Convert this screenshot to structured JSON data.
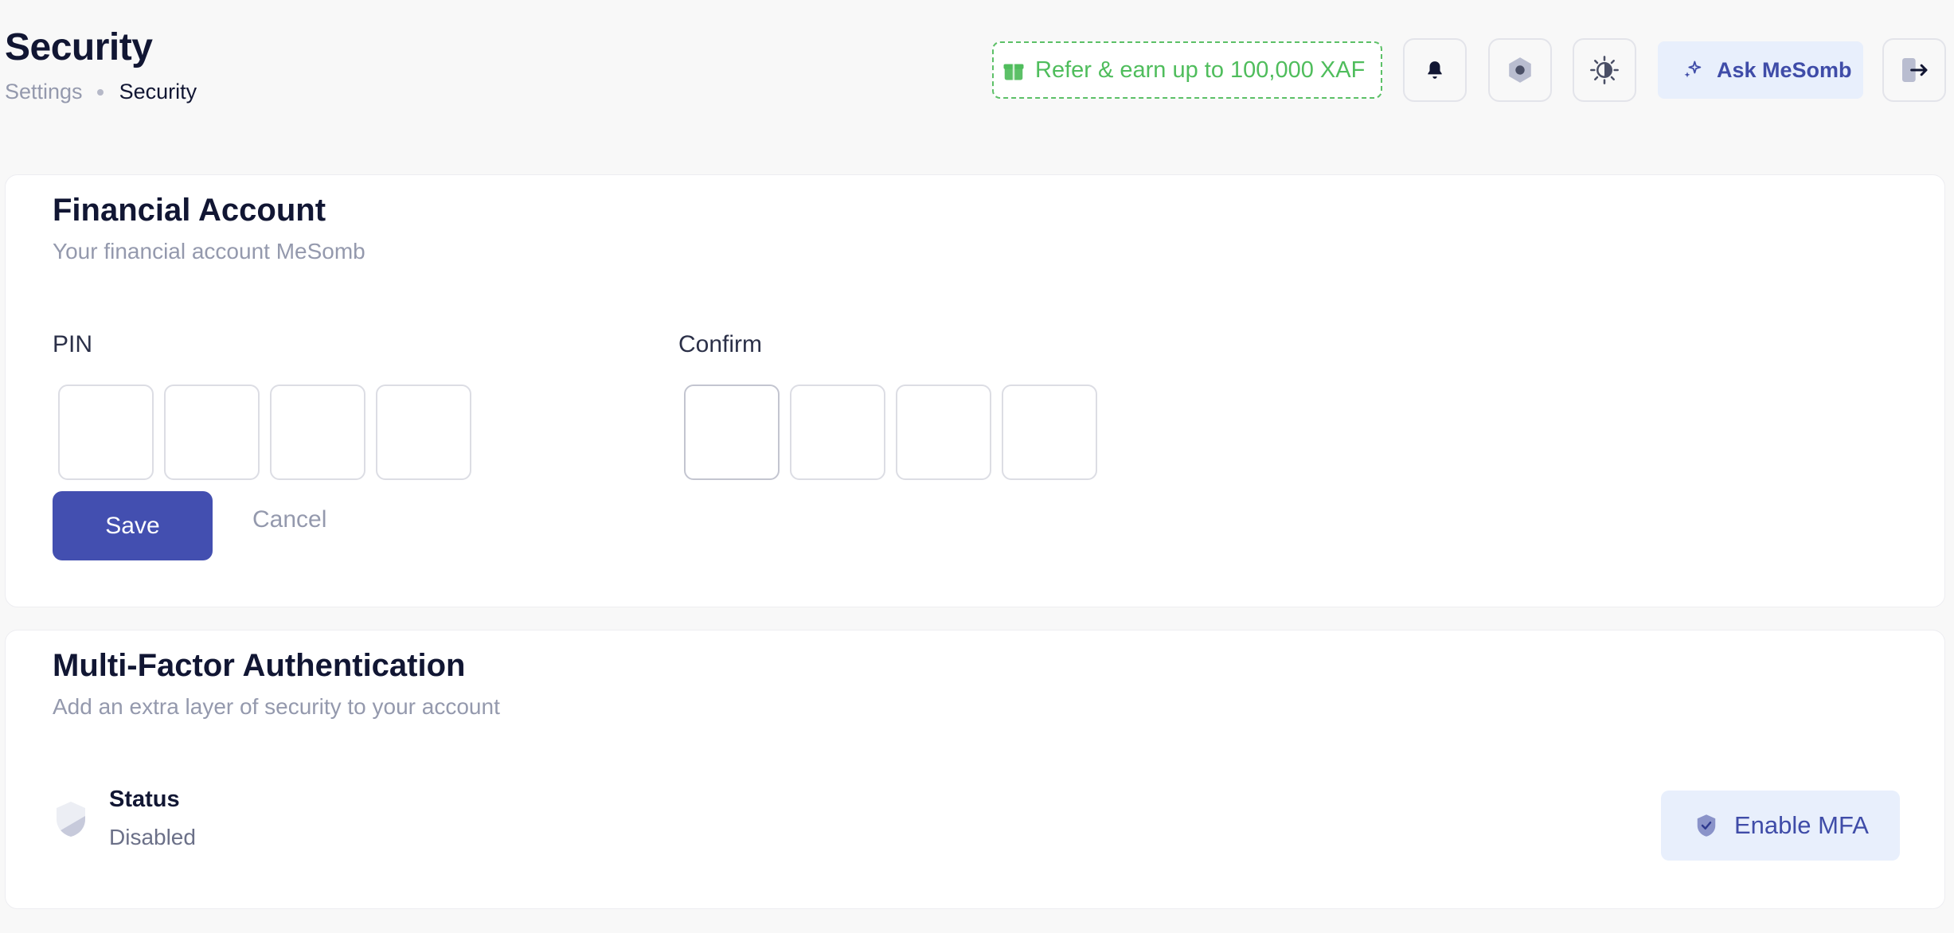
{
  "header": {
    "title": "Security",
    "breadcrumb": {
      "parent": "Settings",
      "current": "Security"
    },
    "refer_label": "Refer & earn up to 100,000 XAF",
    "ask_label": "Ask MeSomb",
    "icons": [
      "gift-icon",
      "bell-icon",
      "hexagon-icon",
      "theme-toggle-icon",
      "sparkles-icon",
      "logout-icon"
    ]
  },
  "financial_account": {
    "title": "Financial Account",
    "subtitle": "Your financial account MeSomb",
    "pin_label": "PIN",
    "confirm_label": "Confirm",
    "pin_values": [
      "",
      "",
      "",
      ""
    ],
    "confirm_values": [
      "",
      "",
      "",
      ""
    ],
    "save_label": "Save",
    "cancel_label": "Cancel"
  },
  "mfa": {
    "title": "Multi-Factor Authentication",
    "subtitle": "Add an extra layer of security to your account",
    "status_label": "Status",
    "status_value": "Disabled",
    "enable_label": "Enable MFA"
  },
  "colors": {
    "primary": "#434fb0",
    "refer_green": "#4fbd5c",
    "accent_bg": "#e8effc",
    "muted_text": "#9499ad"
  }
}
